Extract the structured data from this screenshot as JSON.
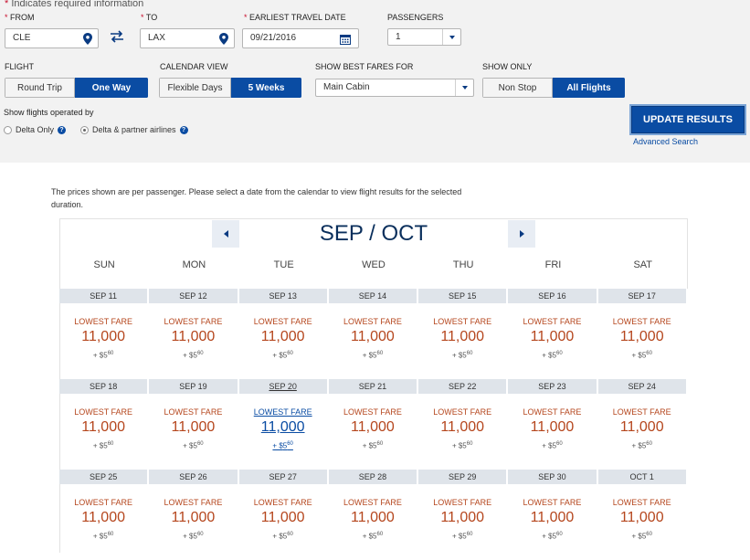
{
  "required_note": "Indicates required information",
  "from": {
    "label": "FROM",
    "value": "CLE"
  },
  "to": {
    "label": "TO",
    "value": "LAX"
  },
  "date": {
    "label": "EARLIEST TRAVEL DATE",
    "value": "09/21/2016"
  },
  "passengers": {
    "label": "PASSENGERS",
    "value": "1"
  },
  "flight": {
    "label": "FLIGHT",
    "options": [
      "Round Trip",
      "One Way"
    ],
    "selected": "One Way"
  },
  "calendar_view": {
    "label": "CALENDAR VIEW",
    "options": [
      "Flexible Days",
      "5 Weeks"
    ],
    "selected": "5 Weeks"
  },
  "best_fares": {
    "label": "SHOW BEST FARES FOR",
    "value": "Main Cabin"
  },
  "show_only": {
    "label": "SHOW ONLY",
    "options": [
      "Non Stop",
      "All Flights"
    ],
    "selected": "All Flights"
  },
  "operated_by": {
    "label": "Show flights operated by",
    "options": [
      "Delta Only",
      "Delta & partner airlines"
    ],
    "selected": "Delta & partner airlines",
    "help_glyph": "?"
  },
  "update_button": "UPDATE RESULTS",
  "advanced_search": "Advanced Search",
  "info_text": "The prices shown are per passenger. Please select a date from the calendar to view flight results for the selected duration.",
  "calendar": {
    "month_title": "SEP / OCT",
    "days_of_week": [
      "SUN",
      "MON",
      "TUE",
      "WED",
      "THU",
      "FRI",
      "SAT"
    ],
    "fare_label": "LOWEST FARE",
    "miles": "11,000",
    "tax_prefix": "+ $",
    "tax_whole": "5",
    "tax_cents": "60",
    "selected_date": "SEP 20",
    "weeks": [
      [
        "SEP 11",
        "SEP 12",
        "SEP 13",
        "SEP 14",
        "SEP 15",
        "SEP 16",
        "SEP 17"
      ],
      [
        "SEP 18",
        "SEP 19",
        "SEP 20",
        "SEP 21",
        "SEP 22",
        "SEP 23",
        "SEP 24"
      ],
      [
        "SEP 25",
        "SEP 26",
        "SEP 27",
        "SEP 28",
        "SEP 29",
        "SEP 30",
        "OCT 1"
      ]
    ]
  },
  "colors": {
    "brand_blue": "#0a4ca3",
    "fare_orange": "#b5461d",
    "required_red": "#c8102e",
    "date_header_bg": "#dfe4ea"
  }
}
